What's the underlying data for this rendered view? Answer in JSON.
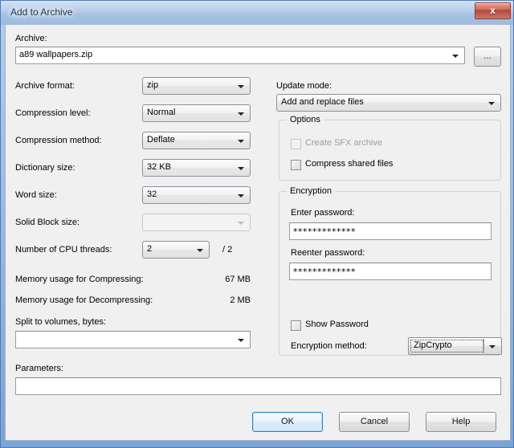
{
  "window": {
    "title": "Add to Archive",
    "close_label": "x"
  },
  "archive": {
    "label": "Archive:",
    "value": "a89 wallpapers.zip",
    "browse_label": "..."
  },
  "left": {
    "archive_format": {
      "label": "Archive format:",
      "value": "zip"
    },
    "compression_level": {
      "label": "Compression level:",
      "value": "Normal"
    },
    "compression_method": {
      "label": "Compression method:",
      "value": "Deflate"
    },
    "dictionary_size": {
      "label": "Dictionary size:",
      "value": "32 KB"
    },
    "word_size": {
      "label": "Word size:",
      "value": "32"
    },
    "solid_block_size": {
      "label": "Solid Block size:",
      "value": ""
    },
    "cpu_threads": {
      "label": "Number of CPU threads:",
      "value": "2",
      "total": "/ 2"
    },
    "memory_compress": {
      "label": "Memory usage for Compressing:",
      "value": "67 MB"
    },
    "memory_decompress": {
      "label": "Memory usage for Decompressing:",
      "value": "2 MB"
    },
    "split_volumes": {
      "label": "Split to volumes, bytes:",
      "value": ""
    },
    "parameters": {
      "label": "Parameters:",
      "value": ""
    }
  },
  "right": {
    "update_mode": {
      "label": "Update mode:",
      "value": "Add and replace files"
    },
    "options": {
      "title": "Options",
      "create_sfx": {
        "label": "Create SFX archive",
        "checked": false,
        "disabled": true
      },
      "compress_shared": {
        "label": "Compress shared files",
        "checked": false,
        "disabled": false
      }
    },
    "encryption": {
      "title": "Encryption",
      "enter_password_label": "Enter password:",
      "enter_password_value": "*************",
      "reenter_password_label": "Reenter password:",
      "reenter_password_value": "*************",
      "show_password": {
        "label": "Show Password",
        "checked": false
      },
      "method_label": "Encryption method:",
      "method_value": "ZipCrypto"
    }
  },
  "footer": {
    "ok": "OK",
    "cancel": "Cancel",
    "help": "Help"
  }
}
